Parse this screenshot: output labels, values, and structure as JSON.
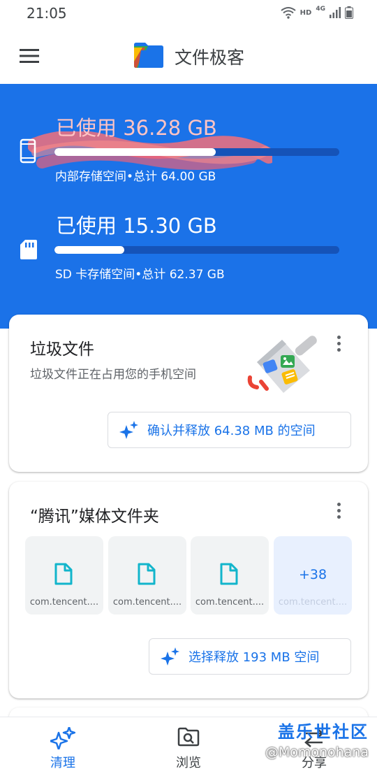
{
  "status_bar": {
    "time": "21:05",
    "hd": "HD",
    "network": "4G"
  },
  "app_bar": {
    "title": "文件极客"
  },
  "storage": {
    "internal": {
      "used_label": "已使用 36.28 GB",
      "used_fraction": 0.567,
      "caption": "内部存储空间•总计 64.00 GB",
      "icon": "phone-icon"
    },
    "sd": {
      "used_label": "已使用 15.30 GB",
      "used_fraction": 0.245,
      "caption": "SD 卡存储空间•总计 62.37 GB",
      "icon": "sd-card-icon"
    }
  },
  "junk_card": {
    "title": "垃圾文件",
    "description": "垃圾文件正在占用您的手机空间",
    "action_label": "确认并释放 64.38 MB 的空间"
  },
  "tencent_card": {
    "title": "“腾讯”媒体文件夹",
    "files": [
      {
        "name": "com.tencent...."
      },
      {
        "name": "com.tencent...."
      },
      {
        "name": "com.tencent...."
      }
    ],
    "more_count": "+38",
    "more_name": "com.tencent....",
    "action_label": "选择释放 193 MB 空间"
  },
  "bottom_nav": {
    "items": [
      {
        "label": "清理",
        "icon": "sparkle-icon",
        "active": true
      },
      {
        "label": "浏览",
        "icon": "browse-icon",
        "active": false
      },
      {
        "label": "分享",
        "icon": "share-icon",
        "active": false
      }
    ]
  },
  "watermark": {
    "site": "盖乐世社区",
    "user": "@Momonohana"
  },
  "colors": {
    "accent": "#1a73e8",
    "banner": "#1b72e8"
  }
}
